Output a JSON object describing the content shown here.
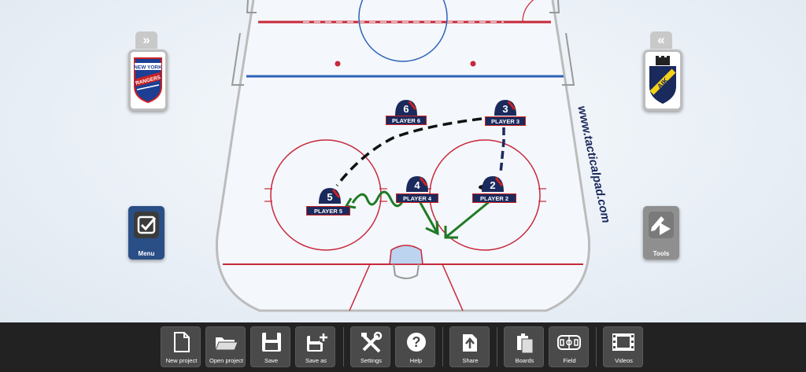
{
  "rink": {
    "watermark": "www.tacticalpad.com"
  },
  "home_team": {
    "logo_line1": "NEW YORK",
    "logo_line2": "RANGERS",
    "expand_icon": "double-chevron-right-icon"
  },
  "away_team": {
    "logo_text": "AIK",
    "expand_icon": "double-chevron-left-icon"
  },
  "side_buttons": {
    "menu_label": "Menu",
    "tools_label": "Tools"
  },
  "players": [
    {
      "number": "6",
      "label": "PLAYER 6"
    },
    {
      "number": "3",
      "label": "PLAYER 3"
    },
    {
      "number": "4",
      "label": "PLAYER 4"
    },
    {
      "number": "2",
      "label": "PLAYER 2"
    },
    {
      "number": "5",
      "label": "PLAYER 5"
    }
  ],
  "toolbar": {
    "items": [
      {
        "label": "New project",
        "icon": "new-file-icon"
      },
      {
        "label": "Open project",
        "icon": "folder-open-icon"
      },
      {
        "label": "Save",
        "icon": "save-icon"
      },
      {
        "label": "Save as",
        "icon": "save-as-icon"
      },
      {
        "label": "Settings",
        "icon": "settings-icon"
      },
      {
        "label": "Help",
        "icon": "help-icon"
      },
      {
        "label": "Share",
        "icon": "share-icon"
      },
      {
        "label": "Boards",
        "icon": "boards-icon"
      },
      {
        "label": "Field",
        "icon": "field-icon"
      },
      {
        "label": "Videos",
        "icon": "videos-icon"
      }
    ]
  },
  "colors": {
    "blue_line": "#2d63b8",
    "red_line": "#c8283a",
    "menu_bg": "#2a4e86",
    "player_navy": "#1b2a5c",
    "arrow_green": "#1f7a25"
  }
}
